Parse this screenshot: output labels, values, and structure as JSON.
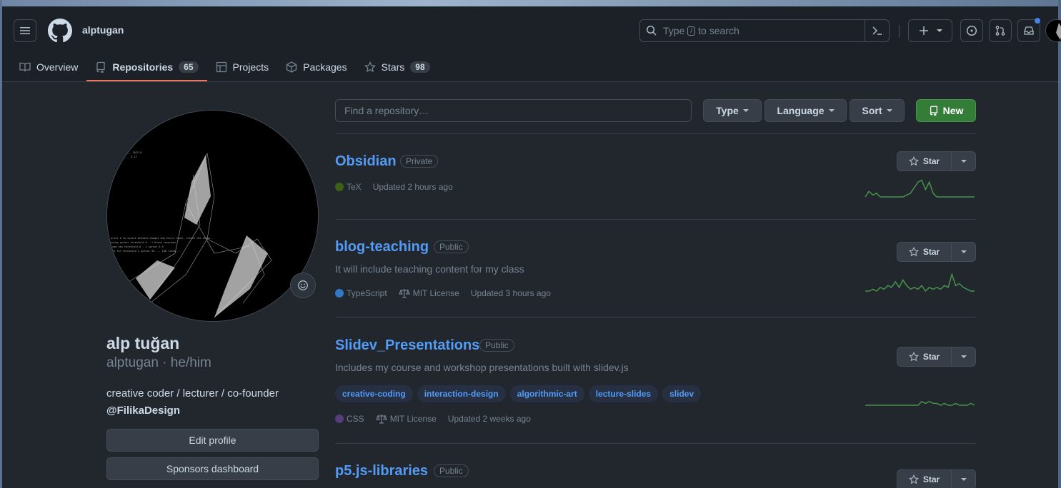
{
  "header": {
    "username": "alptugan",
    "search_placeholder_prefix": "Type",
    "search_key": "/",
    "search_placeholder_suffix": "to search"
  },
  "tabs": [
    {
      "label": "Overview",
      "icon": "book-icon"
    },
    {
      "label": "Repositories",
      "icon": "repo-icon",
      "count": "65",
      "active": true
    },
    {
      "label": "Projects",
      "icon": "table-icon"
    },
    {
      "label": "Packages",
      "icon": "package-icon"
    },
    {
      "label": "Stars",
      "icon": "star-icon",
      "count": "98"
    }
  ],
  "profile": {
    "full_name": "alp tuğan",
    "handle_line": "alptugan · he/him",
    "bio": "creative coder / lecturer / co-founder",
    "org": "@FilikaDesign",
    "edit_label": "Edit profile",
    "sponsors_label": "Sponsors dashboard"
  },
  "controls": {
    "find_placeholder": "Find a repository…",
    "type_label": "Type",
    "language_label": "Language",
    "sort_label": "Sort",
    "new_label": "New"
  },
  "repos": [
    {
      "name": "Obsidian",
      "visibility": "Private",
      "description": "",
      "language": "TeX",
      "language_color": "#3D6117",
      "license": "",
      "updated": "Updated 2 hours ago",
      "topics": [],
      "star_label": "Star",
      "activity": [
        0,
        3,
        1,
        2,
        0,
        0,
        0,
        0,
        0,
        0,
        0,
        1,
        2,
        5,
        8,
        9,
        4,
        8,
        2,
        0,
        0,
        0,
        0,
        0,
        0,
        0,
        0,
        0,
        0,
        0
      ]
    },
    {
      "name": "blog-teaching",
      "visibility": "Public",
      "description": "It will include teaching content for my class",
      "language": "TypeScript",
      "language_color": "#3178c6",
      "license": "MIT License",
      "updated": "Updated 3 hours ago",
      "topics": [],
      "star_label": "Star",
      "activity": [
        0,
        0,
        1,
        0,
        2,
        1,
        3,
        2,
        5,
        2,
        6,
        3,
        1,
        2,
        1,
        3,
        0,
        2,
        1,
        2,
        1,
        3,
        2,
        9,
        3,
        4,
        2,
        1,
        0,
        0
      ]
    },
    {
      "name": "Slidev_Presentations",
      "visibility": "Public",
      "description": "Includes my course and workshop presentations built with slidev.js",
      "language": "CSS",
      "language_color": "#563d7c",
      "license": "MIT License",
      "updated": "Updated 2 weeks ago",
      "topics": [
        "creative-coding",
        "interaction-design",
        "algorithmic-art",
        "lecture-slides",
        "slidev"
      ],
      "star_label": "Star",
      "activity": [
        0,
        0,
        0,
        0,
        0,
        0,
        0,
        0,
        0,
        0,
        0,
        0,
        0,
        0,
        0,
        2,
        1,
        2,
        1,
        1,
        0,
        1,
        0,
        0,
        1,
        0,
        0,
        0,
        1,
        0
      ]
    },
    {
      "name": "p5.js-libraries",
      "visibility": "Public",
      "description": "",
      "language": "",
      "language_color": "",
      "license": "",
      "updated": "",
      "topics": [],
      "star_label": "Star",
      "activity": []
    }
  ]
}
